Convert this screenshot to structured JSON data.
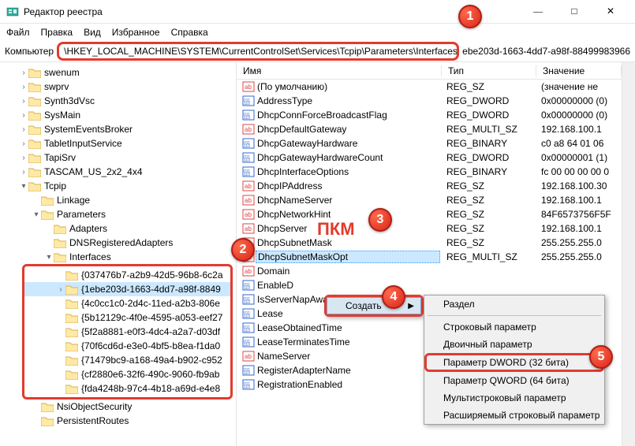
{
  "window": {
    "title": "Редактор реестра"
  },
  "menu": {
    "file": "Файл",
    "edit": "Правка",
    "view": "Вид",
    "favorites": "Избранное",
    "help": "Справка"
  },
  "address": {
    "label": "Компьютер",
    "path": "\\HKEY_LOCAL_MACHINE\\SYSTEM\\CurrentControlSet\\Services\\Tcpip\\Parameters\\Interfaces\\",
    "trail": "ebe203d-1663-4dd7-a98f-88499983966"
  },
  "tree": {
    "top": [
      "swenum",
      "swprv",
      "Synth3dVsc",
      "SysMain",
      "SystemEventsBroker",
      "TabletInputService",
      "TapiSrv",
      "TASCAM_US_2x2_4x4"
    ],
    "tcpip": "Tcpip",
    "tcpip_children": [
      "Linkage"
    ],
    "parameters": "Parameters",
    "param_children": [
      "Adapters",
      "DNSRegisteredAdapters"
    ],
    "interfaces": "Interfaces",
    "guids": [
      "{037476b7-a2b9-42d5-96b8-6c2a",
      "{1ebe203d-1663-4dd7-a98f-8849",
      "{4c0cc1c0-2d4c-11ed-a2b3-806e",
      "{5b12129c-4f0e-4595-a053-eef27",
      "{5f2a8881-e0f3-4dc4-a2a7-d03df",
      "{70f6cd6d-e3e0-4bf5-b8ea-f1da0",
      "{71479bc9-a168-49a4-b902-c952",
      "{cf2880e6-32f6-490c-9060-fb9ab",
      "{fda4248b-97c4-4b18-a69d-e4e8"
    ],
    "bottom": [
      "NsiObjectSecurity",
      "PersistentRoutes"
    ]
  },
  "columns": {
    "name": "Имя",
    "type": "Тип",
    "value": "Значение"
  },
  "registry": {
    "rows": [
      {
        "icon": "sz",
        "name": "(По умолчанию)",
        "type": "REG_SZ",
        "value": "(значение не"
      },
      {
        "icon": "dw",
        "name": "AddressType",
        "type": "REG_DWORD",
        "value": "0x00000000 (0)"
      },
      {
        "icon": "dw",
        "name": "DhcpConnForceBroadcastFlag",
        "type": "REG_DWORD",
        "value": "0x00000000 (0)"
      },
      {
        "icon": "sz",
        "name": "DhcpDefaultGateway",
        "type": "REG_MULTI_SZ",
        "value": "192.168.100.1"
      },
      {
        "icon": "dw",
        "name": "DhcpGatewayHardware",
        "type": "REG_BINARY",
        "value": "c0 a8 64 01 06"
      },
      {
        "icon": "dw",
        "name": "DhcpGatewayHardwareCount",
        "type": "REG_DWORD",
        "value": "0x00000001 (1)"
      },
      {
        "icon": "dw",
        "name": "DhcpInterfaceOptions",
        "type": "REG_BINARY",
        "value": "fc 00 00 00 00 0"
      },
      {
        "icon": "sz",
        "name": "DhcpIPAddress",
        "type": "REG_SZ",
        "value": "192.168.100.30"
      },
      {
        "icon": "sz",
        "name": "DhcpNameServer",
        "type": "REG_SZ",
        "value": "192.168.100.1"
      },
      {
        "icon": "sz",
        "name": "DhcpNetworkHint",
        "type": "REG_SZ",
        "value": "84F6573756F5F"
      },
      {
        "icon": "sz",
        "name": "DhcpServer",
        "type": "REG_SZ",
        "value": "192.168.100.1"
      },
      {
        "icon": "sz",
        "name": "DhcpSubnetMask",
        "type": "REG_SZ",
        "value": "255.255.255.0"
      },
      {
        "icon": "sz",
        "name": "DhcpSubnetMaskOpt",
        "type": "REG_MULTI_SZ",
        "value": "255.255.255.0"
      },
      {
        "icon": "sz",
        "name": "Domain",
        "type": "",
        "value": ""
      },
      {
        "icon": "dw",
        "name": "EnableD",
        "type": "",
        "value": ""
      },
      {
        "icon": "dw",
        "name": "IsServerNapAware",
        "type": "",
        "value": ""
      },
      {
        "icon": "dw",
        "name": "Lease",
        "type": "",
        "value": ""
      },
      {
        "icon": "dw",
        "name": "LeaseObtainedTime",
        "type": "",
        "value": ""
      },
      {
        "icon": "dw",
        "name": "LeaseTerminatesTime",
        "type": "",
        "value": ""
      },
      {
        "icon": "sz",
        "name": "NameServer",
        "type": "",
        "value": ""
      },
      {
        "icon": "dw",
        "name": "RegisterAdapterName",
        "type": "",
        "value": ""
      },
      {
        "icon": "dw",
        "name": "RegistrationEnabled",
        "type": "",
        "value": ""
      }
    ]
  },
  "ctx1": {
    "create": "Создать"
  },
  "ctx2": {
    "key": "Раздел",
    "string": "Строковый параметр",
    "binary": "Двоичный параметр",
    "dword": "Параметр DWORD (32 бита)",
    "qword": "Параметр QWORD (64 бита)",
    "multi": "Мультистроковый параметр",
    "expand": "Расширяемый строковый параметр"
  },
  "annotations": {
    "pkm": "ПКМ"
  }
}
